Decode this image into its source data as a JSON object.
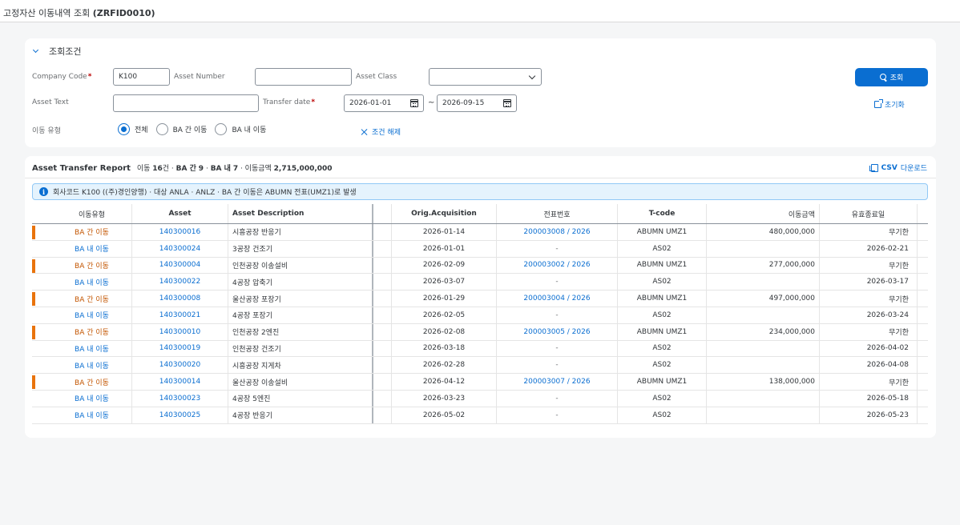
{
  "app": {
    "title_prefix": "고정자산 이동내역 조회",
    "title_code": "(ZRFID0010)"
  },
  "filter": {
    "section_title": "조회조건",
    "company_code": {
      "label": "Company Code",
      "value": "K100",
      "required": "*"
    },
    "asset_number": {
      "label": "Asset Number",
      "value": ""
    },
    "asset_class": {
      "label": "Asset Class",
      "value": ""
    },
    "asset_text": {
      "label": "Asset Text",
      "value": ""
    },
    "transfer_date": {
      "label": "Transfer date",
      "from": "2026-01-01",
      "to": "2026-09-15",
      "separator": "~",
      "required": "*"
    },
    "move_type": {
      "label": "이동 유형",
      "options": [
        "전체",
        "BA 간 이동",
        "BA 내 이동"
      ],
      "selected": "전체"
    },
    "search_button": "조회",
    "reset_button": "초기화",
    "clear_conditions": "조건 해제"
  },
  "report": {
    "title": "Asset Transfer Report",
    "summary": {
      "count_label": "이동",
      "count": "16",
      "count_unit": "건 ·",
      "inter_label": "BA 간",
      "inter": "9",
      "sep1": "·",
      "intra_label": "BA 내",
      "intra": "7",
      "sep2": "· 이동금액",
      "amount": "2,715,000,000"
    },
    "csv": {
      "bold": "CSV",
      "text": "다운로드"
    },
    "info": "회사코드 K100 ((주)경인양행) · 대상 ANLA · ANLZ · BA 간 이동은 ABUMN 전표(UMZ1)로 발생",
    "columns": {
      "type": "이동유형",
      "asset": "Asset",
      "desc": "Asset Description",
      "acq": "Orig.Acquisition",
      "doc": "전표번호",
      "tcode": "T-code",
      "amount": "이동금액",
      "end": "유효종료일"
    },
    "rows": [
      {
        "type": "BA 간 이동",
        "inter": true,
        "asset": "140300016",
        "desc": "시흥공장 반응기",
        "acq": "2026-01-14",
        "doc": "200003008 / 2026",
        "tcode": "ABUMN UMZ1",
        "amount": "480,000,000",
        "end": "무기한"
      },
      {
        "type": "BA 내 이동",
        "inter": false,
        "asset": "140300024",
        "desc": "3공장 건조기",
        "acq": "2026-01-01",
        "doc": "-",
        "tcode": "AS02",
        "amount": "",
        "end": "2026-02-21"
      },
      {
        "type": "BA 간 이동",
        "inter": true,
        "asset": "140300004",
        "desc": "인천공장 이송설비",
        "acq": "2026-02-09",
        "doc": "200003002 / 2026",
        "tcode": "ABUMN UMZ1",
        "amount": "277,000,000",
        "end": "무기한"
      },
      {
        "type": "BA 내 이동",
        "inter": false,
        "asset": "140300022",
        "desc": "4공장 압축기",
        "acq": "2026-03-07",
        "doc": "-",
        "tcode": "AS02",
        "amount": "",
        "end": "2026-03-17"
      },
      {
        "type": "BA 간 이동",
        "inter": true,
        "asset": "140300008",
        "desc": "울산공장 포장기",
        "acq": "2026-01-29",
        "doc": "200003004 / 2026",
        "tcode": "ABUMN UMZ1",
        "amount": "497,000,000",
        "end": "무기한"
      },
      {
        "type": "BA 내 이동",
        "inter": false,
        "asset": "140300021",
        "desc": "4공장 포장기",
        "acq": "2026-02-05",
        "doc": "-",
        "tcode": "AS02",
        "amount": "",
        "end": "2026-03-24"
      },
      {
        "type": "BA 간 이동",
        "inter": true,
        "asset": "140300010",
        "desc": "인천공장 2엔진",
        "acq": "2026-02-08",
        "doc": "200003005 / 2026",
        "tcode": "ABUMN UMZ1",
        "amount": "234,000,000",
        "end": "무기한"
      },
      {
        "type": "BA 내 이동",
        "inter": false,
        "asset": "140300019",
        "desc": "인천공장 건조기",
        "acq": "2026-03-18",
        "doc": "-",
        "tcode": "AS02",
        "amount": "",
        "end": "2026-04-02"
      },
      {
        "type": "BA 내 이동",
        "inter": false,
        "asset": "140300020",
        "desc": "시흥공장 지게차",
        "acq": "2026-02-28",
        "doc": "-",
        "tcode": "AS02",
        "amount": "",
        "end": "2026-04-08"
      },
      {
        "type": "BA 간 이동",
        "inter": true,
        "asset": "140300014",
        "desc": "울산공장 이송설비",
        "acq": "2026-04-12",
        "doc": "200003007 / 2026",
        "tcode": "ABUMN UMZ1",
        "amount": "138,000,000",
        "end": "무기한"
      },
      {
        "type": "BA 내 이동",
        "inter": false,
        "asset": "140300023",
        "desc": "4공장 5엔진",
        "acq": "2026-03-23",
        "doc": "-",
        "tcode": "AS02",
        "amount": "",
        "end": "2026-05-18"
      },
      {
        "type": "BA 내 이동",
        "inter": false,
        "asset": "140300025",
        "desc": "4공장 반응기",
        "acq": "2026-05-02",
        "doc": "-",
        "tcode": "AS02",
        "amount": "",
        "end": "2026-05-23"
      }
    ]
  },
  "colors": {
    "accent": "#0a6ed1",
    "inter_move": "#c35500",
    "inter_marker": "#e9730c",
    "info_bg": "#e5f3fd"
  }
}
